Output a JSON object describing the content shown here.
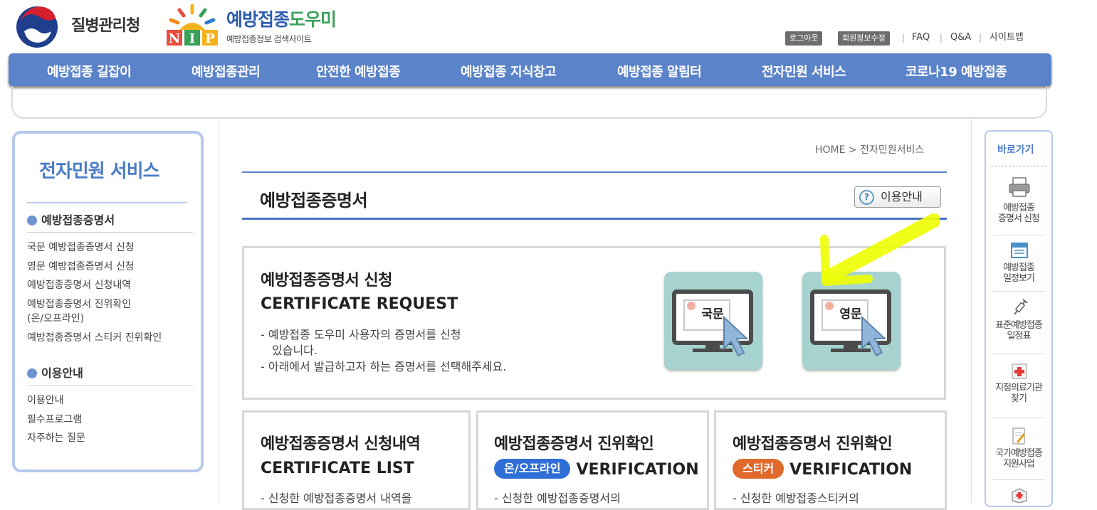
{
  "header": {
    "agency_name": "질병관리청",
    "site_title_part1": "예방접종",
    "site_title_part2": "도우미",
    "site_subtitle": "예방접종정보 검색사이트",
    "logout_label": "로그아웃",
    "edit_member_label": "회원정보수정",
    "faq_label": "FAQ",
    "qna_label": "Q&A",
    "sitemap_label": "사이트맵",
    "separator": "|"
  },
  "gnb": {
    "items": [
      {
        "label": "예방접종 길잡이"
      },
      {
        "label": "예방접종관리"
      },
      {
        "label": "안전한 예방접종"
      },
      {
        "label": "예방접종 지식창고"
      },
      {
        "label": "예방접종 알림터"
      },
      {
        "label": "전자민원 서비스"
      },
      {
        "label": "코로나19 예방접종"
      }
    ]
  },
  "sidebar": {
    "title": "전자민원 서비스",
    "sections": [
      {
        "heading": "예방접종증명서",
        "links": [
          "국문 예방접종증명서 신청",
          "영문 예방접종증명서 신청",
          "예방접종증명서 신청내역",
          "예방접종증명서 진위확인",
          "(온/오프라인)",
          "예방접종증명서 스티커 진위확인"
        ]
      },
      {
        "heading": "이용안내",
        "links": [
          "이용안내",
          "필수프로그램",
          "자주하는 질문"
        ]
      }
    ]
  },
  "main": {
    "breadcrumb": "HOME > 전자민원서비스",
    "page_title": "예방접종증명서",
    "help_button_label": "이용안내",
    "help_icon_glyph": "?",
    "request_box": {
      "title_kr": "예방접종증명서 신청",
      "title_en": "CERTIFICATE REQUEST",
      "desc_line1": "- 예방접종 도우미 사용자의 증명서를 신청",
      "desc_line2": "있습니다.",
      "desc_line3": "- 아래에서 발급하고자 하는 증명서를 선택해주세요.",
      "korean_card_label": "국문",
      "english_card_label": "영문"
    },
    "list_box": {
      "title_kr": "예방접종증명서 신청내역",
      "title_en": "CERTIFICATE LIST",
      "desc": "- 신청한 예방접종증명서 내역을"
    },
    "verify_box": {
      "title_kr": "예방접종증명서 진위확인",
      "badge": "온/오프라인",
      "title_en": "VERIFICATION",
      "desc": "- 신청한 예방접종증명서의"
    },
    "sticker_box": {
      "title_kr": "예방접종증명서 진위확인",
      "badge": "스티커",
      "title_en": "VERIFICATION",
      "desc": "- 신청한 예방접종스티커의"
    }
  },
  "quick_menu": {
    "title": "바로가기",
    "items": [
      {
        "line1": "예방접종",
        "line2": "증명서 신청",
        "icon": "printer-icon"
      },
      {
        "line1": "예방접종",
        "line2": "일정보기",
        "icon": "calendar-icon"
      },
      {
        "line1": "표준예방접종",
        "line2": "일정표",
        "icon": "syringe-icon"
      },
      {
        "line1": "지정의료기관",
        "line2": "찾기",
        "icon": "medical-cross-icon"
      },
      {
        "line1": "국가예방접종",
        "line2": "지원사업",
        "icon": "document-pencil-icon"
      }
    ]
  },
  "colors": {
    "gnb_blue": "#5b83c9",
    "sidebar_border": "#b7c9ea",
    "card_teal": "#a6d3cf",
    "badge_blue": "#2f6ed6",
    "badge_orange": "#e0692b",
    "highlight_yellow": "#eeff00"
  }
}
